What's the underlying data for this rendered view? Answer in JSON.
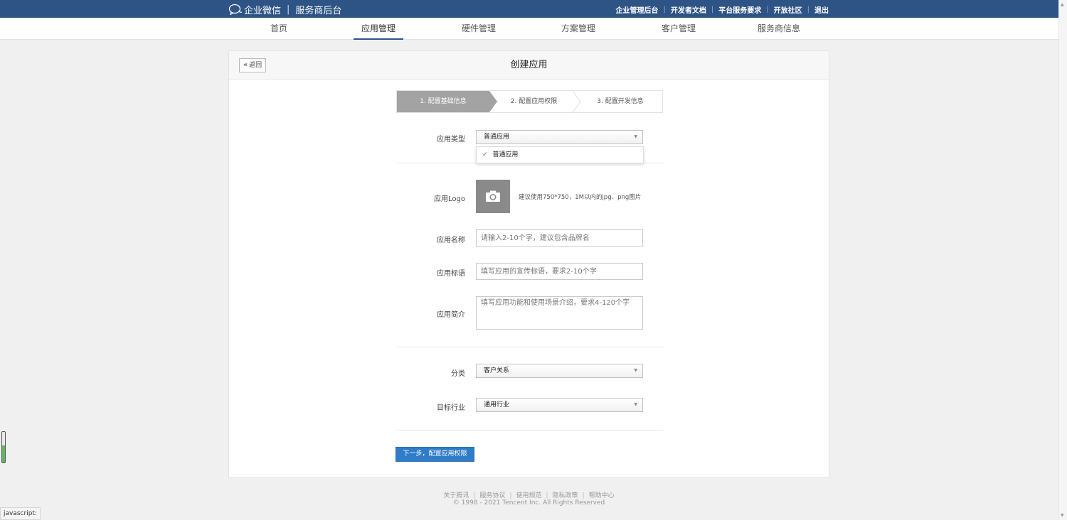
{
  "topbar": {
    "brand_name": "企业微信",
    "brand_separator": "|",
    "brand_sub": "服务商后台",
    "links": [
      "企业管理后台",
      "开发者文档",
      "平台服务要求",
      "开放社区",
      "退出"
    ]
  },
  "nav": {
    "items": [
      "首页",
      "应用管理",
      "硬件管理",
      "方案管理",
      "客户管理",
      "服务商信息"
    ],
    "active": "应用管理"
  },
  "card": {
    "back_label": "返回",
    "title": "创建应用"
  },
  "steps": [
    "1. 配置基础信息",
    "2. 配置应用权限",
    "3. 配置开发信息"
  ],
  "form": {
    "app_type_label": "应用类型",
    "app_type_value": "普通应用",
    "app_type_options": [
      "普通应用"
    ],
    "logo_label": "应用Logo",
    "logo_hint": "建议使用750*750，1M以内的jpg、png图片",
    "name_label": "应用名称",
    "name_placeholder": "请输入2-10个字，建议包含品牌名",
    "slogan_label": "应用标语",
    "slogan_placeholder": "填写应用的宣传标语，要求2-10个字",
    "intro_label": "应用简介",
    "intro_placeholder": "填写应用功能和使用场景介绍，要求4-120个字",
    "category_label": "分类",
    "category_value": "客户关系",
    "industry_label": "目标行业",
    "industry_value": "通用行业",
    "next_button": "下一步，配置应用权限"
  },
  "footer": {
    "links": [
      "关于腾讯",
      "服务协议",
      "使用规范",
      "隐私政策",
      "帮助中心"
    ],
    "copyright": "© 1998 - 2021 Tencent Inc. All Rights Reserved"
  },
  "status_bar": {
    "url": "javascript:"
  },
  "colors": {
    "topbar": "#2e5486",
    "primary_button": "#2f7dc8",
    "step_active": "#a3a3a3"
  },
  "icons": [
    "chat-bubble-icon",
    "camera-icon",
    "checkmark-icon",
    "chevron-left-icon",
    "caret-down-icon"
  ]
}
